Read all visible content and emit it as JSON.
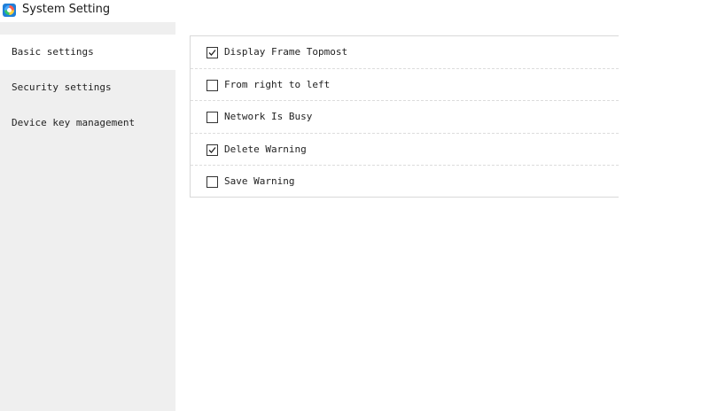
{
  "window": {
    "title": "System Setting",
    "icon": "app-logo-icon"
  },
  "sidebar": {
    "items": [
      {
        "label": "Basic settings",
        "active": true
      },
      {
        "label": "Security settings",
        "active": false
      },
      {
        "label": "Device key management",
        "active": false
      }
    ]
  },
  "options": [
    {
      "label": "Display Frame Topmost",
      "checked": true
    },
    {
      "label": "From right to left",
      "checked": false
    },
    {
      "label": "Network Is Busy",
      "checked": false
    },
    {
      "label": "Delete Warning",
      "checked": true
    },
    {
      "label": "Save Warning",
      "checked": false
    }
  ],
  "colors": {
    "sidebar_bg": "#efefef",
    "active_item_bg": "#ffffff",
    "panel_border": "#d8d8d8"
  }
}
